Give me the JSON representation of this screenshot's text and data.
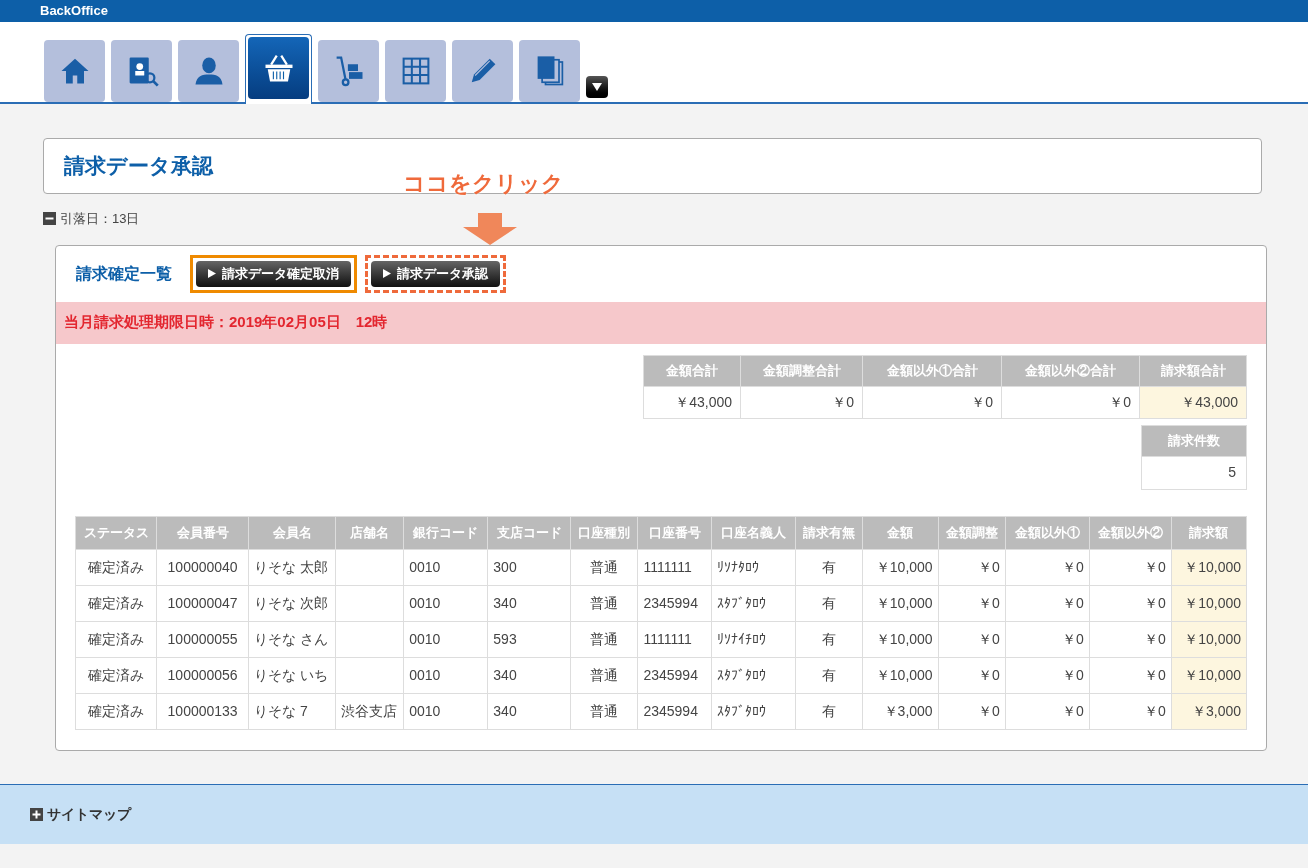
{
  "header": {
    "title": "BackOffice"
  },
  "nav": {
    "tabs": [
      {
        "kind": "home",
        "selected": false
      },
      {
        "kind": "contacts",
        "selected": false
      },
      {
        "kind": "user",
        "selected": false
      },
      {
        "kind": "basket",
        "selected": true
      },
      {
        "kind": "dolly",
        "selected": false
      },
      {
        "kind": "grid",
        "selected": false
      },
      {
        "kind": "pencil",
        "selected": false
      },
      {
        "kind": "copies",
        "selected": false
      }
    ]
  },
  "page_title": "請求データ承認",
  "debit_date": {
    "text": "引落日：13日",
    "expanded": true
  },
  "annotation": {
    "text": "ココをクリック"
  },
  "panel": {
    "title": "請求確定一覧",
    "buttons": [
      {
        "label": "請求データ確定取消",
        "kind": "solid"
      },
      {
        "label": "請求データ承認",
        "kind": "dashed"
      }
    ],
    "deadline": "当月請求処理期限日時：2019年02月05日　12時",
    "totals": {
      "columns": [
        {
          "label": "金額合計",
          "kind": "amount"
        },
        {
          "label": "金額調整合計",
          "kind": "amount"
        },
        {
          "label": "金額以外①合計",
          "kind": "amount"
        },
        {
          "label": "金額以外②合計",
          "kind": "amount"
        },
        {
          "label": "請求額合計",
          "kind": "total"
        }
      ],
      "values": [
        "￥43,000",
        "￥0",
        "￥0",
        "￥0",
        "￥43,000"
      ]
    },
    "count": {
      "label": "請求件数",
      "value": "5"
    },
    "table": {
      "columns": [
        {
          "label": "ステータス",
          "kind": "center"
        },
        {
          "label": "会員番号",
          "kind": "center"
        },
        {
          "label": "会員名",
          "kind": "text"
        },
        {
          "label": "店舗名",
          "kind": "text"
        },
        {
          "label": "銀行コード",
          "kind": "text"
        },
        {
          "label": "支店コード",
          "kind": "text"
        },
        {
          "label": "口座種別",
          "kind": "center"
        },
        {
          "label": "口座番号",
          "kind": "text"
        },
        {
          "label": "口座名義人",
          "kind": "text"
        },
        {
          "label": "請求有無",
          "kind": "center"
        },
        {
          "label": "金額",
          "kind": "amount"
        },
        {
          "label": "金額調整",
          "kind": "amount"
        },
        {
          "label": "金額以外①",
          "kind": "amount"
        },
        {
          "label": "金額以外②",
          "kind": "amount"
        },
        {
          "label": "請求額",
          "kind": "total"
        }
      ],
      "rows": [
        [
          "確定済み",
          "100000040",
          "りそな 太郎",
          "",
          "0010",
          "300",
          "普通",
          "1111111",
          "ﾘｿﾅﾀﾛｳ",
          "有",
          "￥10,000",
          "￥0",
          "￥0",
          "￥0",
          "￥10,000"
        ],
        [
          "確定済み",
          "100000047",
          "りそな 次郎",
          "",
          "0010",
          "340",
          "普通",
          "2345994",
          "ｽﾀﾌﾞﾀﾛｳ",
          "有",
          "￥10,000",
          "￥0",
          "￥0",
          "￥0",
          "￥10,000"
        ],
        [
          "確定済み",
          "100000055",
          "りそな さん",
          "",
          "0010",
          "593",
          "普通",
          "1111111",
          "ﾘｿﾅｲﾁﾛｳ",
          "有",
          "￥10,000",
          "￥0",
          "￥0",
          "￥0",
          "￥10,000"
        ],
        [
          "確定済み",
          "100000056",
          "りそな いち",
          "",
          "0010",
          "340",
          "普通",
          "2345994",
          "ｽﾀﾌﾞﾀﾛｳ",
          "有",
          "￥10,000",
          "￥0",
          "￥0",
          "￥0",
          "￥10,000"
        ],
        [
          "確定済み",
          "100000133",
          "りそな 7",
          "渋谷支店",
          "0010",
          "340",
          "普通",
          "2345994",
          "ｽﾀﾌﾞﾀﾛｳ",
          "有",
          "￥3,000",
          "￥0",
          "￥0",
          "￥0",
          "￥3,000"
        ]
      ]
    }
  },
  "footer": {
    "label": "サイトマップ",
    "expanded": false
  }
}
